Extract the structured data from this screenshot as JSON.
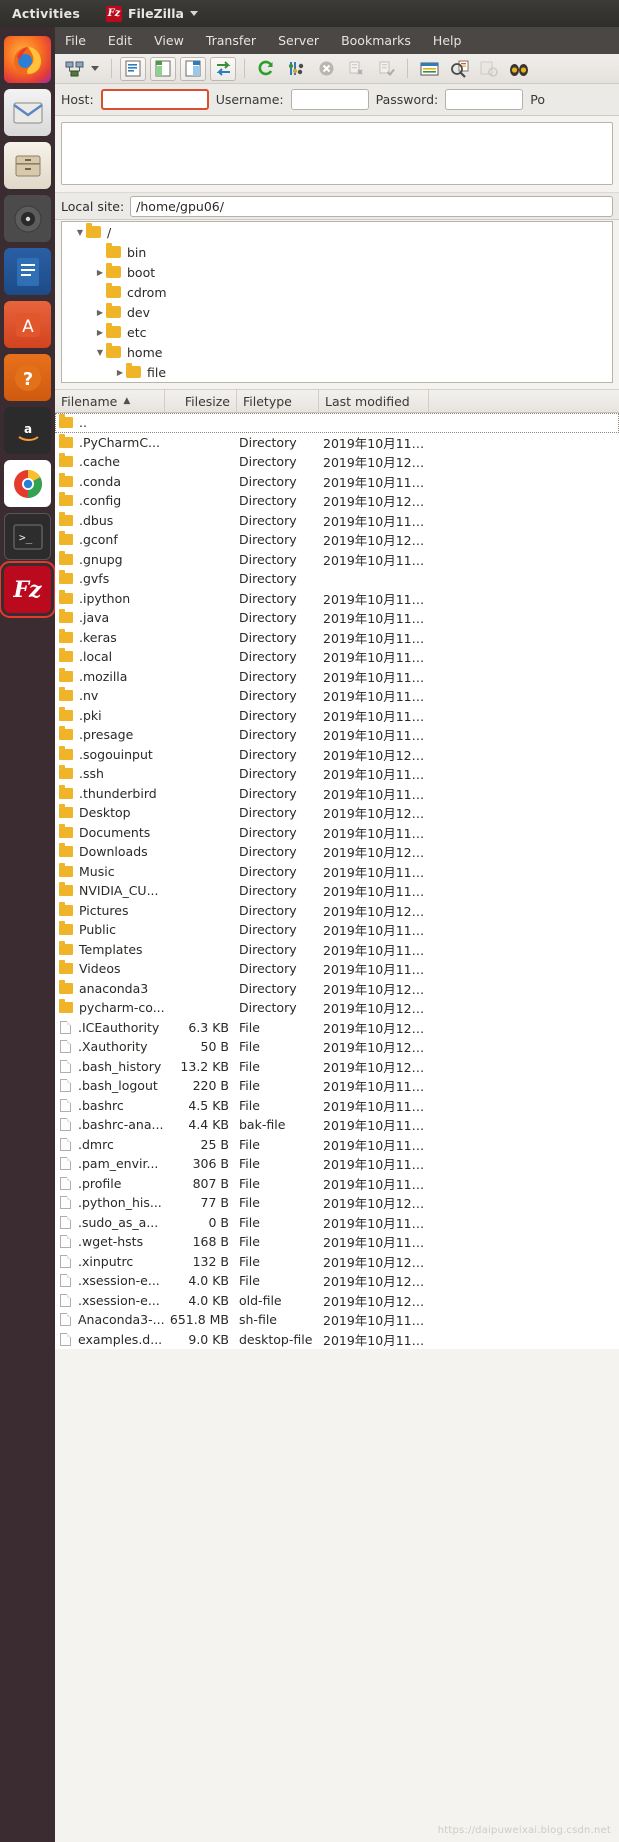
{
  "topbar": {
    "activities": "Activities",
    "app_name": "FileZilla",
    "app_icon": "filezilla-icon",
    "menu_caret": "chevron-down-icon"
  },
  "launcher": {
    "items": [
      {
        "name": "firefox",
        "label": "Firefox"
      },
      {
        "name": "thunderbird",
        "label": "Thunderbird Mail"
      },
      {
        "name": "files",
        "label": "Files"
      },
      {
        "name": "rhythmbox",
        "label": "Rhythmbox"
      },
      {
        "name": "libreoffice-writer",
        "label": "LibreOffice Writer"
      },
      {
        "name": "ubuntu-software",
        "label": "Ubuntu Software"
      },
      {
        "name": "help",
        "label": "Help"
      },
      {
        "name": "amazon",
        "label": "Amazon"
      },
      {
        "name": "chrome",
        "label": "Google Chrome"
      },
      {
        "name": "terminal",
        "label": "Terminal"
      },
      {
        "name": "filezilla",
        "label": "FileZilla"
      }
    ],
    "highlight_color": "#e33a2e"
  },
  "menubar": {
    "items": [
      "File",
      "Edit",
      "View",
      "Transfer",
      "Server",
      "Bookmarks",
      "Help"
    ]
  },
  "toolbar": {
    "buttons": [
      {
        "name": "site-manager-icon",
        "enabled": true
      },
      {
        "name": "site-manager-dropdown-icon",
        "enabled": true
      },
      {
        "name": "toggle-message-log-icon",
        "enabled": true
      },
      {
        "name": "toggle-local-tree-icon",
        "enabled": true
      },
      {
        "name": "toggle-remote-tree-icon",
        "enabled": true
      },
      {
        "name": "toggle-transfer-queue-icon",
        "enabled": true
      },
      {
        "name": "refresh-icon",
        "enabled": true
      },
      {
        "name": "process-queue-icon",
        "enabled": true
      },
      {
        "name": "cancel-icon",
        "enabled": true
      },
      {
        "name": "disconnect-icon",
        "enabled": false
      },
      {
        "name": "reconnect-icon",
        "enabled": false
      },
      {
        "name": "filter-icon",
        "enabled": true
      },
      {
        "name": "compare-directories-icon",
        "enabled": true
      },
      {
        "name": "synchronized-browsing-icon",
        "enabled": false
      },
      {
        "name": "find-files-icon",
        "enabled": true
      }
    ]
  },
  "quickconnect": {
    "host_label": "Host:",
    "host_value": "",
    "host_placeholder": "",
    "username_label": "Username:",
    "username_value": "",
    "password_label": "Password:",
    "password_value": "",
    "port_label": "Po",
    "port_value": "",
    "host_focus_color": "#d9502e"
  },
  "local_site": {
    "label": "Local site:",
    "path": "/home/gpu06/"
  },
  "tree": {
    "nodes": [
      {
        "label": "/",
        "depth": 0,
        "state": "open"
      },
      {
        "label": "bin",
        "depth": 1,
        "state": "leaf"
      },
      {
        "label": "boot",
        "depth": 1,
        "state": "closed"
      },
      {
        "label": "cdrom",
        "depth": 1,
        "state": "leaf"
      },
      {
        "label": "dev",
        "depth": 1,
        "state": "closed"
      },
      {
        "label": "etc",
        "depth": 1,
        "state": "closed"
      },
      {
        "label": "home",
        "depth": 1,
        "state": "open"
      },
      {
        "label": "file",
        "depth": 2,
        "state": "closed"
      },
      {
        "label": "",
        "depth": 2,
        "state": "partial"
      }
    ]
  },
  "filelist": {
    "columns": [
      {
        "key": "filename",
        "label": "Filename",
        "sort": "asc",
        "sort_icon": "caret-up-icon"
      },
      {
        "key": "filesize",
        "label": "Filesize"
      },
      {
        "key": "filetype",
        "label": "Filetype"
      },
      {
        "key": "modified",
        "label": "Last modified"
      }
    ],
    "rows": [
      {
        "name": "..",
        "size": "",
        "type": "",
        "modified": "",
        "icon": "folder-icon",
        "focused": true
      },
      {
        "name": ".PyCharmC...",
        "size": "",
        "type": "Directory",
        "modified": "2019年10月11…",
        "icon": "folder-icon"
      },
      {
        "name": ".cache",
        "size": "",
        "type": "Directory",
        "modified": "2019年10月12…",
        "icon": "folder-icon"
      },
      {
        "name": ".conda",
        "size": "",
        "type": "Directory",
        "modified": "2019年10月11…",
        "icon": "folder-icon"
      },
      {
        "name": ".config",
        "size": "",
        "type": "Directory",
        "modified": "2019年10月12…",
        "icon": "folder-icon"
      },
      {
        "name": ".dbus",
        "size": "",
        "type": "Directory",
        "modified": "2019年10月11…",
        "icon": "folder-icon"
      },
      {
        "name": ".gconf",
        "size": "",
        "type": "Directory",
        "modified": "2019年10月12…",
        "icon": "folder-icon"
      },
      {
        "name": ".gnupg",
        "size": "",
        "type": "Directory",
        "modified": "2019年10月11…",
        "icon": "folder-icon"
      },
      {
        "name": ".gvfs",
        "size": "",
        "type": "Directory",
        "modified": "",
        "icon": "folder-icon"
      },
      {
        "name": ".ipython",
        "size": "",
        "type": "Directory",
        "modified": "2019年10月11…",
        "icon": "folder-icon"
      },
      {
        "name": ".java",
        "size": "",
        "type": "Directory",
        "modified": "2019年10月11…",
        "icon": "folder-icon"
      },
      {
        "name": ".keras",
        "size": "",
        "type": "Directory",
        "modified": "2019年10月11…",
        "icon": "folder-icon"
      },
      {
        "name": ".local",
        "size": "",
        "type": "Directory",
        "modified": "2019年10月11…",
        "icon": "folder-icon"
      },
      {
        "name": ".mozilla",
        "size": "",
        "type": "Directory",
        "modified": "2019年10月11…",
        "icon": "folder-icon"
      },
      {
        "name": ".nv",
        "size": "",
        "type": "Directory",
        "modified": "2019年10月11…",
        "icon": "folder-icon"
      },
      {
        "name": ".pki",
        "size": "",
        "type": "Directory",
        "modified": "2019年10月11…",
        "icon": "folder-icon"
      },
      {
        "name": ".presage",
        "size": "",
        "type": "Directory",
        "modified": "2019年10月11…",
        "icon": "folder-icon"
      },
      {
        "name": ".sogouinput",
        "size": "",
        "type": "Directory",
        "modified": "2019年10月12…",
        "icon": "folder-icon"
      },
      {
        "name": ".ssh",
        "size": "",
        "type": "Directory",
        "modified": "2019年10月11…",
        "icon": "folder-icon"
      },
      {
        "name": ".thunderbird",
        "size": "",
        "type": "Directory",
        "modified": "2019年10月11…",
        "icon": "folder-icon"
      },
      {
        "name": "Desktop",
        "size": "",
        "type": "Directory",
        "modified": "2019年10月12…",
        "icon": "folder-icon"
      },
      {
        "name": "Documents",
        "size": "",
        "type": "Directory",
        "modified": "2019年10月11…",
        "icon": "folder-icon"
      },
      {
        "name": "Downloads",
        "size": "",
        "type": "Directory",
        "modified": "2019年10月12…",
        "icon": "folder-icon"
      },
      {
        "name": "Music",
        "size": "",
        "type": "Directory",
        "modified": "2019年10月11…",
        "icon": "folder-icon"
      },
      {
        "name": "NVIDIA_CU...",
        "size": "",
        "type": "Directory",
        "modified": "2019年10月11…",
        "icon": "folder-icon"
      },
      {
        "name": "Pictures",
        "size": "",
        "type": "Directory",
        "modified": "2019年10月12…",
        "icon": "folder-icon"
      },
      {
        "name": "Public",
        "size": "",
        "type": "Directory",
        "modified": "2019年10月11…",
        "icon": "folder-icon"
      },
      {
        "name": "Templates",
        "size": "",
        "type": "Directory",
        "modified": "2019年10月11…",
        "icon": "folder-icon"
      },
      {
        "name": "Videos",
        "size": "",
        "type": "Directory",
        "modified": "2019年10月11…",
        "icon": "folder-icon"
      },
      {
        "name": "anaconda3",
        "size": "",
        "type": "Directory",
        "modified": "2019年10月12…",
        "icon": "folder-icon"
      },
      {
        "name": "pycharm-co...",
        "size": "",
        "type": "Directory",
        "modified": "2019年10月12…",
        "icon": "folder-icon"
      },
      {
        "name": ".ICEauthority",
        "size": "6.3 KB",
        "type": "File",
        "modified": "2019年10月12…",
        "icon": "file-icon"
      },
      {
        "name": ".Xauthority",
        "size": "50 B",
        "type": "File",
        "modified": "2019年10月12…",
        "icon": "file-icon"
      },
      {
        "name": ".bash_history",
        "size": "13.2 KB",
        "type": "File",
        "modified": "2019年10月12…",
        "icon": "file-icon"
      },
      {
        "name": ".bash_logout",
        "size": "220 B",
        "type": "File",
        "modified": "2019年10月11…",
        "icon": "file-icon"
      },
      {
        "name": ".bashrc",
        "size": "4.5 KB",
        "type": "File",
        "modified": "2019年10月11…",
        "icon": "file-icon"
      },
      {
        "name": ".bashrc-ana...",
        "size": "4.4 KB",
        "type": "bak-file",
        "modified": "2019年10月11…",
        "icon": "file-icon"
      },
      {
        "name": ".dmrc",
        "size": "25 B",
        "type": "File",
        "modified": "2019年10月11…",
        "icon": "file-icon"
      },
      {
        "name": ".pam_envir...",
        "size": "306 B",
        "type": "File",
        "modified": "2019年10月11…",
        "icon": "file-icon"
      },
      {
        "name": ".profile",
        "size": "807 B",
        "type": "File",
        "modified": "2019年10月11…",
        "icon": "file-icon"
      },
      {
        "name": ".python_his...",
        "size": "77 B",
        "type": "File",
        "modified": "2019年10月12…",
        "icon": "file-icon"
      },
      {
        "name": ".sudo_as_a...",
        "size": "0 B",
        "type": "File",
        "modified": "2019年10月11…",
        "icon": "file-icon"
      },
      {
        "name": ".wget-hsts",
        "size": "168 B",
        "type": "File",
        "modified": "2019年10月11…",
        "icon": "file-icon"
      },
      {
        "name": ".xinputrc",
        "size": "132 B",
        "type": "File",
        "modified": "2019年10月12…",
        "icon": "file-icon"
      },
      {
        "name": ".xsession-e...",
        "size": "4.0 KB",
        "type": "File",
        "modified": "2019年10月12…",
        "icon": "file-icon"
      },
      {
        "name": ".xsession-e...",
        "size": "4.0 KB",
        "type": "old-file",
        "modified": "2019年10月12…",
        "icon": "file-icon"
      },
      {
        "name": "Anaconda3-...",
        "size": "651.8 MB",
        "type": "sh-file",
        "modified": "2019年10月11…",
        "icon": "file-icon"
      },
      {
        "name": "examples.d...",
        "size": "9.0 KB",
        "type": "desktop-file",
        "modified": "2019年10月11…",
        "icon": "file-icon"
      }
    ]
  },
  "watermark": "https://daipuweixai.blog.csdn.net"
}
